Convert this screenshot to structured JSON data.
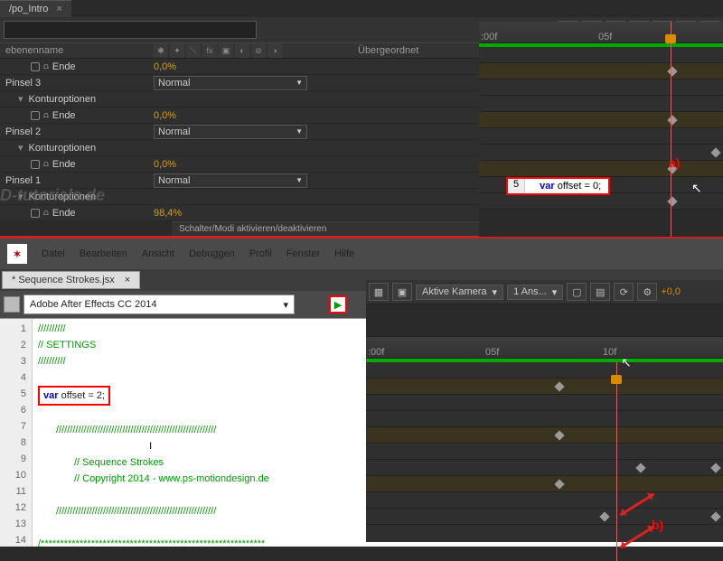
{
  "tab_title": "/po_Intro",
  "col_headers": {
    "name": "ebenenname",
    "parent": "Übergeordnet"
  },
  "layers": [
    {
      "label": "Ende",
      "value": "0,0%",
      "indent": 2
    },
    {
      "label": "Pinsel 3",
      "value": "Normal",
      "dropdown": true,
      "indent": 0
    },
    {
      "label": "Konturoptionen",
      "indent": 1,
      "tw": true
    },
    {
      "label": "Ende",
      "value": "0,0%",
      "indent": 2
    },
    {
      "label": "Pinsel 2",
      "value": "Normal",
      "dropdown": true,
      "indent": 0
    },
    {
      "label": "Konturoptionen",
      "indent": 1,
      "tw": true
    },
    {
      "label": "Ende",
      "value": "0,0%",
      "indent": 2
    },
    {
      "label": "Pinsel 1",
      "value": "Normal",
      "dropdown": true,
      "indent": 0
    },
    {
      "label": "Konturoptionen",
      "indent": 1,
      "tw": true
    },
    {
      "label": "Ende",
      "value": "98,4%",
      "indent": 2
    }
  ],
  "watermark": "D-tutorials.de",
  "mode_toggle": "Schalter/Modi aktivieren/deaktivieren",
  "ruler1": {
    "start": ":00f",
    "mid": "05f"
  },
  "callout_a": {
    "line": "5",
    "kw": "var",
    "rest": " offset = 0;"
  },
  "ann_a": "a)",
  "estk": {
    "menus": [
      "Datei",
      "Bearbeiten",
      "Ansicht",
      "Debuggen",
      "Profil",
      "Fenster",
      "Hilfe"
    ],
    "tab": "* Sequence Strokes.jsx",
    "target": "Adobe After Effects CC 2014"
  },
  "code": {
    "lines": [
      "1",
      "2",
      "3",
      "4",
      "5",
      "6",
      "7",
      "8",
      "9",
      "10",
      "11",
      "12",
      "13",
      "14"
    ],
    "l1": "//////////",
    "l2": "// SETTINGS",
    "l3": "//////////",
    "l5_kw": "var",
    "l5_rest": " offset = 2;",
    "l7": "//////////////////////////////////////////////////////////",
    "l9": "// Sequence Strokes",
    "l10": "// Copyright 2014 - www.ps-motiondesign.de",
    "l12": "//////////////////////////////////////////////////////////",
    "l14": "/**********************************************************"
  },
  "panel": {
    "camera": "Aktive Kamera",
    "views": "1 Ans...",
    "accent": "+0,0"
  },
  "ruler2": {
    "start": ":00f",
    "mid": "05f",
    "end": "10f"
  },
  "ann_b": "b)"
}
